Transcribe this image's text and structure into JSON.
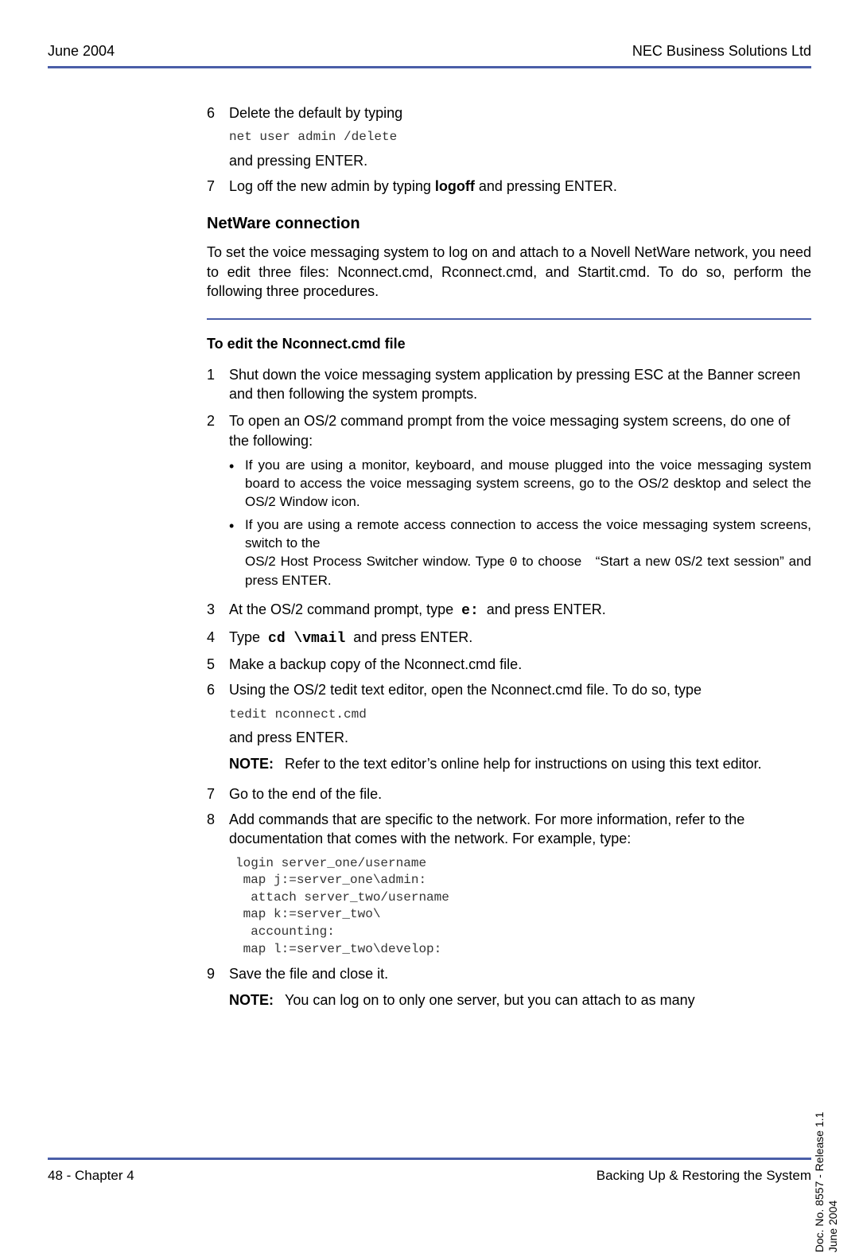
{
  "header": {
    "left": "June 2004",
    "right": "NEC Business Solutions Ltd"
  },
  "step6": {
    "num": "6",
    "text": "Delete the default by typing",
    "code": "net user admin /delete",
    "after": "and pressing ENTER."
  },
  "step7": {
    "num": "7",
    "pre": "Log off the new admin by typing ",
    "bold": "logoff",
    "post": " and pressing ENTER."
  },
  "netware": {
    "heading": "NetWare connection",
    "para": "To set the voice messaging system to log on and attach to a Novell NetWare network, you need to edit three files: Nconnect.cmd, Rconnect.cmd, and Startit.cmd. To do so, perform the following three procedures."
  },
  "proc": {
    "heading": "To edit the Nconnect.cmd file",
    "s1": {
      "num": "1",
      "text": "Shut down the voice messaging system application by pressing ESC at the Banner screen and then following the system prompts."
    },
    "s2": {
      "num": "2",
      "text": "To open an OS/2 command prompt from the voice messaging system screens, do one of the following:",
      "b1": "If you are using a monitor, keyboard, and mouse plugged into the voice messaging system board to access the voice messaging system screens, go to the OS/2 desktop and select the OS/2 Window icon.",
      "b2a": "If you are using a remote access connection to access the voice messaging system screens, switch to the",
      "b2b": "OS/2 Host Process Switcher window. Type ",
      "b2code": "0",
      "b2c": " to choose   “Start a new 0S/2 text session” and press ENTER."
    },
    "s3": {
      "num": "3",
      "pre": "At the OS/2 command prompt, type  ",
      "code": "e:",
      "post": "  and press ENTER."
    },
    "s4": {
      "num": "4",
      "pre": "Type  ",
      "code": "cd \\vmail",
      "post": "  and press ENTER."
    },
    "s5": {
      "num": "5",
      "text": "Make a backup copy of the Nconnect.cmd file."
    },
    "s6": {
      "num": "6",
      "text": "Using the OS/2 tedit text editor, open the Nconnect.cmd file. To do so, type",
      "code": "tedit nconnect.cmd",
      "after": "and press ENTER.",
      "noteLabel": "NOTE:",
      "noteBody": "Refer to the text editor’s online help for instructions on using this text editor."
    },
    "s7": {
      "num": "7",
      "text": "Go to the end of the file."
    },
    "s8": {
      "num": "8",
      "text": "Add commands that are specific to the network. For more information, refer to the documentation that comes with the network. For example, type:",
      "code": "login server_one/username\n map j:=server_one\\admin:\n  attach server_two/username\n map k:=server_two\\\n  accounting:\n map l:=server_two\\develop:"
    },
    "s9": {
      "num": "9",
      "text": "Save the file and close it.",
      "noteLabel": "NOTE:",
      "noteBody": "You can log on to only one server, but you can attach to as many"
    }
  },
  "side": {
    "line1": "Doc. No. 8557 - Release 1.1",
    "line2": "June 2004"
  },
  "footer": {
    "left": "48 - Chapter 4",
    "right": "Backing Up & Restoring the System"
  }
}
